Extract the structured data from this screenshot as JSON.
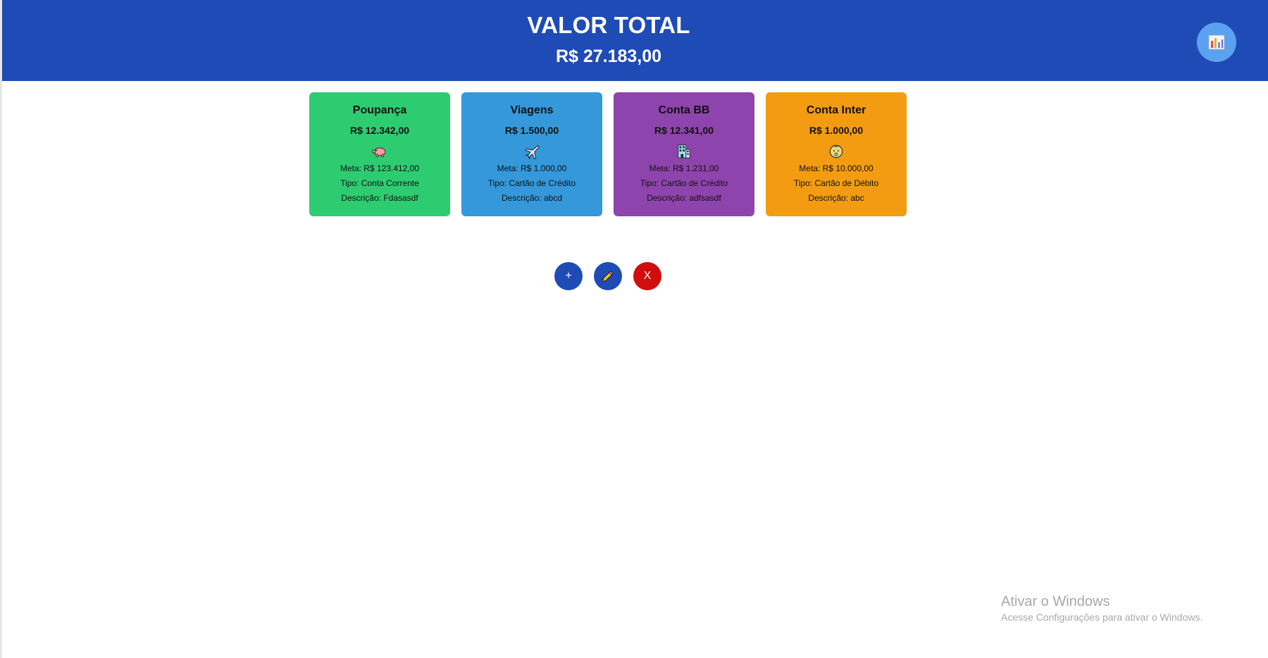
{
  "header": {
    "title": "VALOR TOTAL",
    "total": "R$ 27.183,00",
    "chart_button_icon": "bar-chart-icon",
    "background_color": "#1f4bb7"
  },
  "accounts": [
    {
      "name": "Poupança",
      "balance": "R$ 12.342,00",
      "icon": "pig-icon",
      "goal": "Meta: R$ 123.412,00",
      "type": "Tipo: Conta Corrente",
      "description": "Descrição: Fdasasdf",
      "color": "#2ecc71"
    },
    {
      "name": "Viagens",
      "balance": "R$ 1.500,00",
      "icon": "airplane-icon",
      "goal": "Meta: R$ 1.000,00",
      "type": "Tipo: Cartão de Crédito",
      "description": "Descrição: abcd",
      "color": "#3498db"
    },
    {
      "name": "Conta BB",
      "balance": "R$ 12.341,00",
      "icon": "bank-building-icon",
      "goal": "Meta: R$ 1.231,00",
      "type": "Tipo: Cartão de Crédito",
      "description": "Descrição: adfsasdf",
      "color": "#8e44ad"
    },
    {
      "name": "Conta Inter",
      "balance": "R$ 1.000,00",
      "icon": "baby-face-icon",
      "goal": "Meta: R$ 10.000,00",
      "type": "Tipo: Cartão de Débito",
      "description": "Descrição: abc",
      "color": "#f39c12"
    }
  ],
  "actions": {
    "add_label": "+",
    "edit_icon": "pencil-icon",
    "delete_label": "X",
    "add_color": "#1f4bb7",
    "edit_color": "#1f4bb7",
    "delete_color": "#d10d0d"
  },
  "watermark": {
    "title": "Ativar o Windows",
    "subtitle": "Acesse Configurações para ativar o Windows."
  }
}
